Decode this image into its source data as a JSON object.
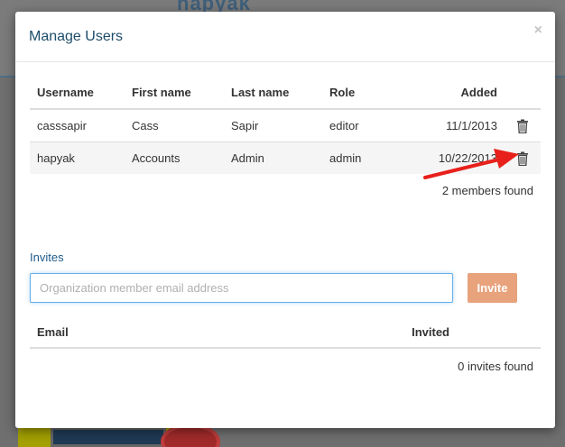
{
  "background": {
    "logo_text": "hapyak"
  },
  "modal": {
    "title": "Manage Users",
    "close_symbol": "×"
  },
  "members": {
    "columns": [
      "Username",
      "First name",
      "Last name",
      "Role",
      "Added"
    ],
    "rows": [
      {
        "username": "casssapir",
        "first": "Cass",
        "last": "Sapir",
        "role": "editor",
        "added": "11/1/2013"
      },
      {
        "username": "hapyak",
        "first": "Accounts",
        "last": "Admin",
        "role": "admin",
        "added": "10/22/2013"
      }
    ],
    "count_text": "2 members found",
    "delete_icon": "trash-icon"
  },
  "invites": {
    "label": "Invites",
    "email_placeholder": "Organization member email address",
    "email_value": "",
    "invite_button": "Invite",
    "columns": [
      "Email",
      "Invited"
    ],
    "count_text": "0 invites found"
  },
  "colors": {
    "title": "#1e4d6b",
    "invite_button": "#e8a27c",
    "input_focus": "#66afe9",
    "annotation_arrow": "#e8201b"
  }
}
